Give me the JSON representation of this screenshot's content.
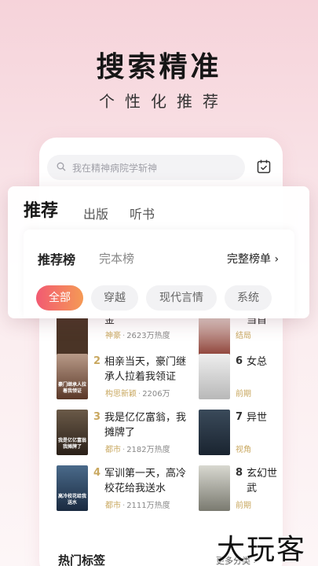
{
  "hero": {
    "title": "搜索精准",
    "subtitle": "个性化推荐"
  },
  "search": {
    "placeholder": "我在精神病院学斩神"
  },
  "tabs": [
    "推荐",
    "出版",
    "听书"
  ],
  "sub_tabs": {
    "active": "推荐榜",
    "other": "完本榜",
    "full_list": "完整榜单 ›"
  },
  "chips": [
    "全部",
    "穿越",
    "现代言情",
    "系统"
  ],
  "rank_left": [
    {
      "num": "",
      "title": "金",
      "category": "神豪",
      "heat": "2623万热度",
      "cover_text": "",
      "cover_color": "#5a4030"
    },
    {
      "num": "2",
      "title": "相亲当天，豪门继承人拉着我领证",
      "category": "构思新颖",
      "heat": "2206万",
      "cover_text": "豪门继承人拉着我领证",
      "cover_color": "#6b4a3a"
    },
    {
      "num": "3",
      "title": "我是亿亿富翁，我摊牌了",
      "category": "都市",
      "heat": "2182万热度",
      "cover_text": "我是亿亿富翁我摊牌了",
      "cover_color": "#3a3026"
    },
    {
      "num": "4",
      "title": "军训第一天，高冷校花给我送水",
      "category": "都市",
      "heat": "2111万热度",
      "cover_text": "高冷校花给我送水",
      "cover_color": "#2a3d5a"
    }
  ],
  "rank_right": [
    {
      "num": "",
      "title": "当首",
      "meta": "结局",
      "cover_color": "#5a2a20"
    },
    {
      "num": "6",
      "title": "女总",
      "meta": "前期",
      "cover_color": "#c8c8c8"
    },
    {
      "num": "7",
      "title": "异世",
      "meta": "视角",
      "cover_color": "#2a3a4a"
    },
    {
      "num": "8",
      "title": "玄幻世武",
      "meta": "前期",
      "cover_color": "#a8a8a0"
    }
  ],
  "dot": "·",
  "hot_tags": "热门标签",
  "more_categories": "更多分类 ›",
  "watermark": "大玩客",
  "colors": {
    "accent_gold": "#c9a860",
    "chip_gradient_start": "#f25a72",
    "chip_gradient_end": "#f59a55"
  }
}
